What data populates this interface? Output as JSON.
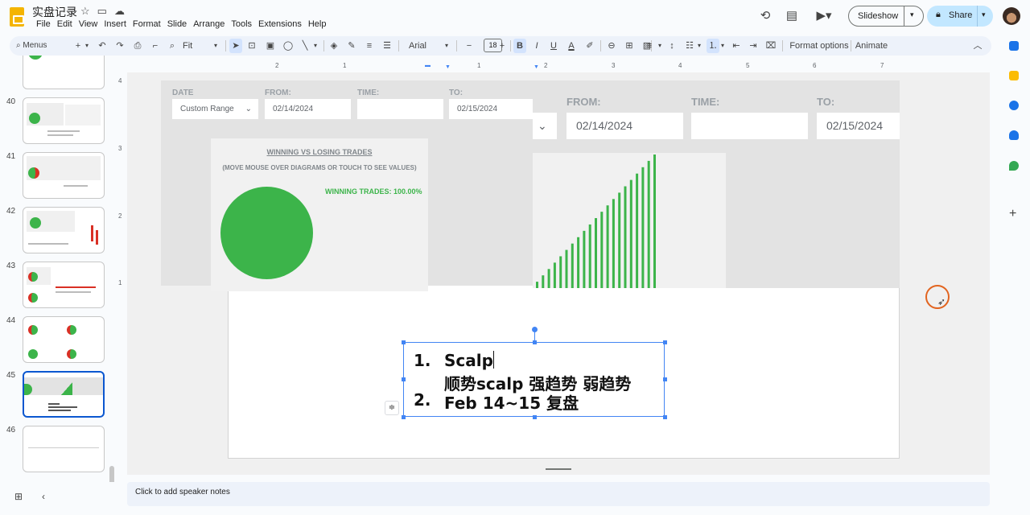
{
  "app": {
    "doc_title": "实盘记录",
    "menus": [
      "File",
      "Edit",
      "View",
      "Insert",
      "Format",
      "Slide",
      "Arrange",
      "Tools",
      "Extensions",
      "Help"
    ],
    "slideshow_label": "Slideshow",
    "share_label": "Share"
  },
  "toolbar": {
    "search_label": "Menus",
    "zoom_label": "Fit",
    "font_name": "Arial",
    "font_size": "18",
    "format_options_label": "Format options",
    "animate_label": "Animate"
  },
  "ruler": {
    "ticks": [
      "2",
      "1",
      "1",
      "2",
      "3",
      "4",
      "5",
      "6",
      "7"
    ],
    "vticks": [
      "4",
      "3",
      "2",
      "1"
    ]
  },
  "filmstrip": {
    "slides": [
      {
        "num": ""
      },
      {
        "num": "40"
      },
      {
        "num": "41"
      },
      {
        "num": "42"
      },
      {
        "num": "43"
      },
      {
        "num": "44"
      },
      {
        "num": "45",
        "selected": true
      },
      {
        "num": "46"
      }
    ]
  },
  "slide": {
    "left_panel": {
      "date_label": "DATE",
      "from_label": "FROM:",
      "time_label": "TIME:",
      "to_label": "TO:",
      "range_value": "Custom Range",
      "from_value": "02/14/2024",
      "to_value": "02/15/2024",
      "chart_title": "WINNING VS LOSING TRADES",
      "chart_subtitle": "(MOVE MOUSE OVER DIAGRAMS OR TOUCH TO SEE VALUES)",
      "winning_label": "WINNING TRADES: 100.00%"
    },
    "right_panel": {
      "from_label": "FROM:",
      "time_label": "TIME:",
      "to_label": "TO:",
      "from_value": "02/14/2024",
      "to_value": "02/15/2024"
    },
    "textbox": {
      "item1_num": "1.",
      "item1_text": "Scalp",
      "item1_sub": "顺势scalp  强趋势 弱趋势",
      "item2_num": "2.",
      "item2_text": "Feb 14~15 复盘"
    }
  },
  "notes_placeholder": "Click to add speaker notes",
  "colors": {
    "accent": "#0b57d0",
    "win_green": "#3cb44a",
    "share_bg": "#c2e7ff"
  },
  "chart_data": {
    "type": "bar",
    "values": [
      1,
      2,
      3,
      4,
      5,
      6,
      7,
      8,
      9,
      10,
      11,
      12,
      13,
      14,
      15,
      16,
      17,
      18,
      19,
      20,
      21
    ],
    "ylim": [
      0,
      21
    ]
  }
}
